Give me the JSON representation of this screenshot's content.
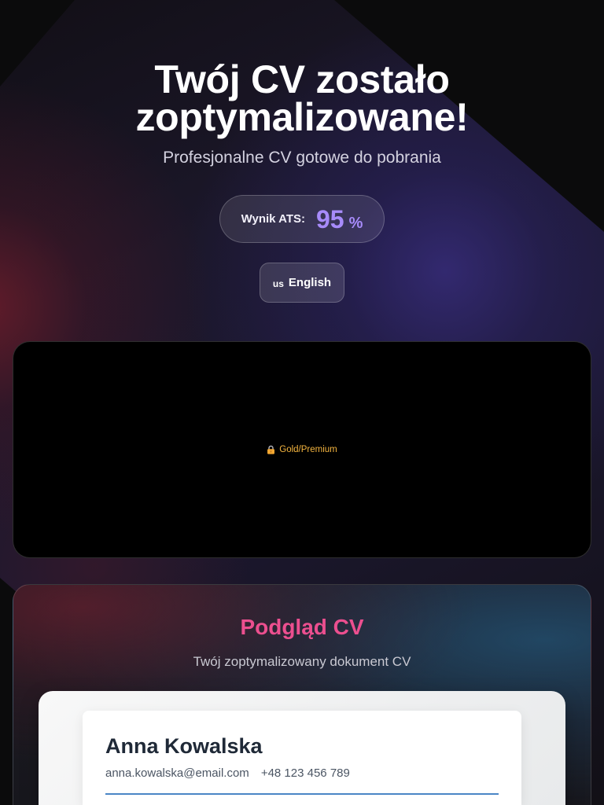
{
  "header": {
    "title": "Twój CV zostało zoptymalizowane!",
    "subtitle": "Profesjonalne CV gotowe do pobrania"
  },
  "ats_badge": {
    "label": "Wynik ATS:",
    "score": "95",
    "unit": "%"
  },
  "language_selector": {
    "flag": "us",
    "label": "English",
    "flag_icon": "us-flag-icon"
  },
  "locked_panel": {
    "icon": "lock-icon",
    "badge": "Gold/Premium"
  },
  "cv_preview": {
    "title": "Podgląd CV",
    "subtitle": "Twój zoptymalizowany dokument CV",
    "document": {
      "name": "Anna Kowalska",
      "email": "anna.kowalska@email.com",
      "phone": "+48 123 456 789"
    }
  },
  "colors": {
    "page_background": "#0b0b0c",
    "ats_score": "#a78bfa",
    "preview_title": "#ec4f8f",
    "premium_badge": "#f3b43f",
    "document_divider": "#4a86c6",
    "document_text": "#1f2937"
  }
}
